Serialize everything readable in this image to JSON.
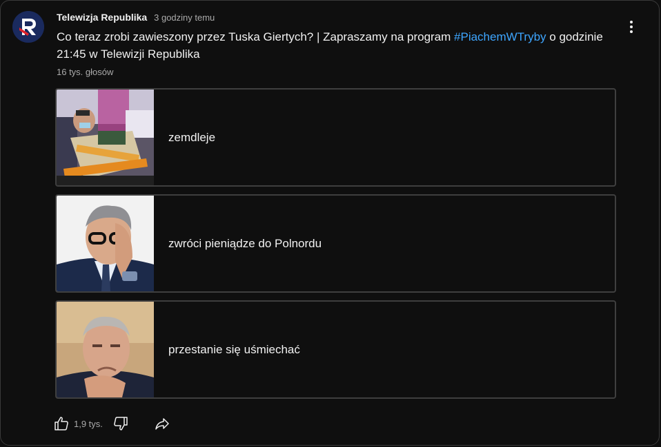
{
  "post": {
    "channel": "Telewizja Republika",
    "time": "3 godziny temu",
    "text_before": "Co teraz zrobi zawieszony przez Tuska Giertych? | Zapraszamy na program ",
    "hashtag": "#PiachemWTryby",
    "text_after": " o godzinie 21:45 w Telewizji Republika",
    "votes": "16 tys. głosów"
  },
  "poll": {
    "options": [
      {
        "label": "zemdleje",
        "image": "ambulance-stretcher-photo"
      },
      {
        "label": "zwróci pieniądze do Polnordu",
        "image": "man-with-glasses-rubbing-eye-photo"
      },
      {
        "label": "przestanie się uśmiechać",
        "image": "man-resting-chin-on-hand-photo"
      }
    ]
  },
  "actions": {
    "like_count": "1,9 tys.",
    "like_icon": "thumbs-up-icon",
    "dislike_icon": "thumbs-down-icon",
    "share_icon": "share-icon",
    "more_icon": "more-vertical-icon"
  },
  "colors": {
    "background": "#0f0f0f",
    "hashtag": "#3ea6ff",
    "border": "#3f3f3f",
    "logo_bg": "#1a2a5e",
    "logo_red": "#e2232a"
  }
}
